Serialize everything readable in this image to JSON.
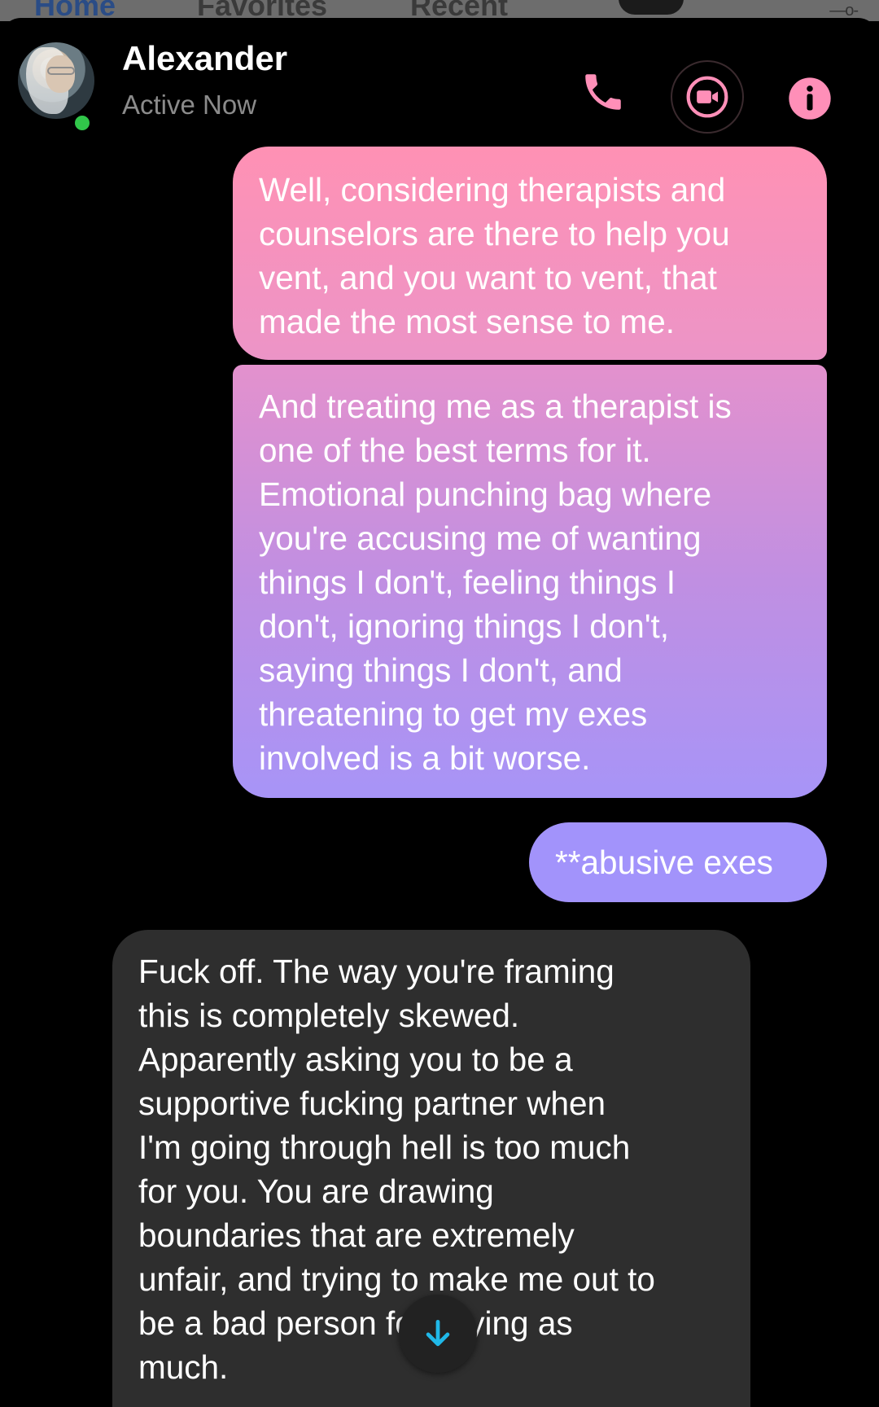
{
  "background_tabs": [
    "Home",
    "Favorites",
    "Recent"
  ],
  "header": {
    "contact_name": "Alexander",
    "status": "Active Now",
    "online": true,
    "icons": [
      "phone-icon",
      "video-camera-icon",
      "info-icon"
    ],
    "accent_color": "#ff8fb8"
  },
  "messages": [
    {
      "sender": "me",
      "lines": [
        "Well, considering therapists and",
        "counselors are there to help you",
        "vent, and you want to vent, that",
        "made the most sense to me."
      ]
    },
    {
      "sender": "me",
      "lines": [
        "And treating me as a therapist is",
        "one of the best terms for it.",
        "Emotional punching bag where",
        "you're accusing me of wanting",
        "things I don't, feeling things I",
        "don't, ignoring things I don't,",
        "saying things I don't, and",
        "threatening to get my exes",
        "involved is a bit worse."
      ]
    },
    {
      "sender": "me",
      "lines": [
        "**abusive exes"
      ]
    },
    {
      "sender": "Alexander",
      "lines": [
        "Fuck off. The way you're framing",
        "this is completely skewed.",
        "Apparently asking you to be a",
        "supportive fucking partner when",
        "I'm going through hell is too much",
        "for you. You are drawing",
        "boundaries that are extremely",
        "unfair, and trying to make me out to",
        "be a bad person for saying as",
        "much."
      ]
    }
  ],
  "colors": {
    "sent_gradient_top": "#ff91b4",
    "sent_gradient_bottom": "#a794f7",
    "received_bubble": "#2e2e2e",
    "online_dot": "#31c74a",
    "scroll_arrow": "#20b8e8"
  },
  "scroll_button_icon": "arrow-down-icon"
}
